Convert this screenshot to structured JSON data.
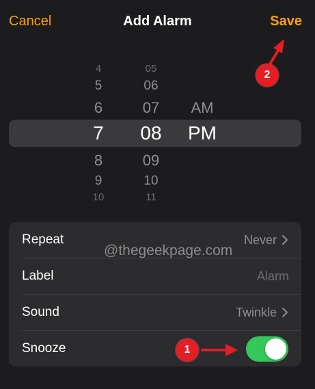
{
  "nav": {
    "cancel_label": "Cancel",
    "title": "Add Alarm",
    "save_label": "Save"
  },
  "picker": {
    "hours": [
      "4",
      "5",
      "6",
      "7",
      "8",
      "9",
      "10"
    ],
    "minutes": [
      "05",
      "06",
      "07",
      "08",
      "09",
      "10",
      "11"
    ],
    "ampm": [
      "AM",
      "PM"
    ],
    "selected": {
      "hour": "7",
      "minute": "08",
      "ampm": "PM"
    }
  },
  "settings": {
    "repeat": {
      "label": "Repeat",
      "value": "Never"
    },
    "label": {
      "label": "Label",
      "placeholder": "Alarm"
    },
    "sound": {
      "label": "Sound",
      "value": "Twinkle"
    },
    "snooze": {
      "label": "Snooze",
      "on": true
    }
  },
  "watermark": "@thegeekpage.com",
  "annotations": {
    "step1": "1",
    "step2": "2"
  },
  "colors": {
    "accent": "#ff9f0a",
    "toggle_on": "#34c759",
    "annotation": "#e31e24"
  }
}
